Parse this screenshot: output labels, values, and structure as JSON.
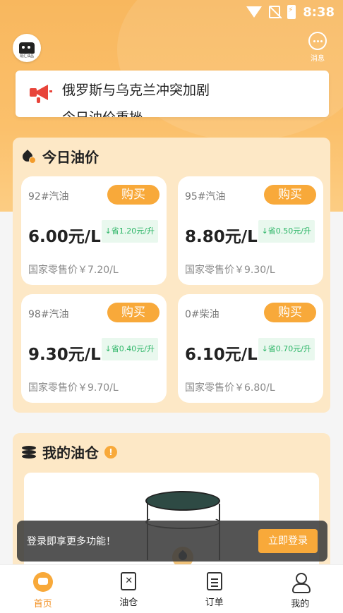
{
  "status_bar": {
    "time": "8:38"
  },
  "header": {
    "logo_text": "易汇油品",
    "message_label": "消息"
  },
  "notice": {
    "lines": [
      "俄罗斯与乌克兰冲突加剧",
      "今日油价重挫"
    ]
  },
  "today_prices": {
    "title": "今日油价",
    "buy_label": "购买",
    "cards": [
      {
        "name": "92#汽油",
        "price": "6.00元/L",
        "saving": "↓省1.20元/升",
        "retail": "国家零售价￥7.20/L"
      },
      {
        "name": "95#汽油",
        "price": "8.80元/L",
        "saving": "↓省0.50元/升",
        "retail": "国家零售价￥9.30/L"
      },
      {
        "name": "98#汽油",
        "price": "9.30元/L",
        "saving": "↓省0.40元/升",
        "retail": "国家零售价￥9.70/L"
      },
      {
        "name": "0#柴油",
        "price": "6.10元/L",
        "saving": "↓省0.70元/升",
        "retail": "国家零售价￥6.80/L"
      }
    ]
  },
  "my_tank": {
    "title": "我的油仓",
    "info_icon": "!"
  },
  "login_toast": {
    "text": "登录即享更多功能！",
    "button": "立即登录"
  },
  "tabbar": {
    "items": [
      {
        "label": "首页"
      },
      {
        "label": "油仓"
      },
      {
        "label": "订单"
      },
      {
        "label": "我的"
      }
    ]
  },
  "colors": {
    "accent": "#f8a93a",
    "hero": "#f8b75e",
    "panel": "#fde8c6",
    "saving_green": "#2bb566"
  }
}
